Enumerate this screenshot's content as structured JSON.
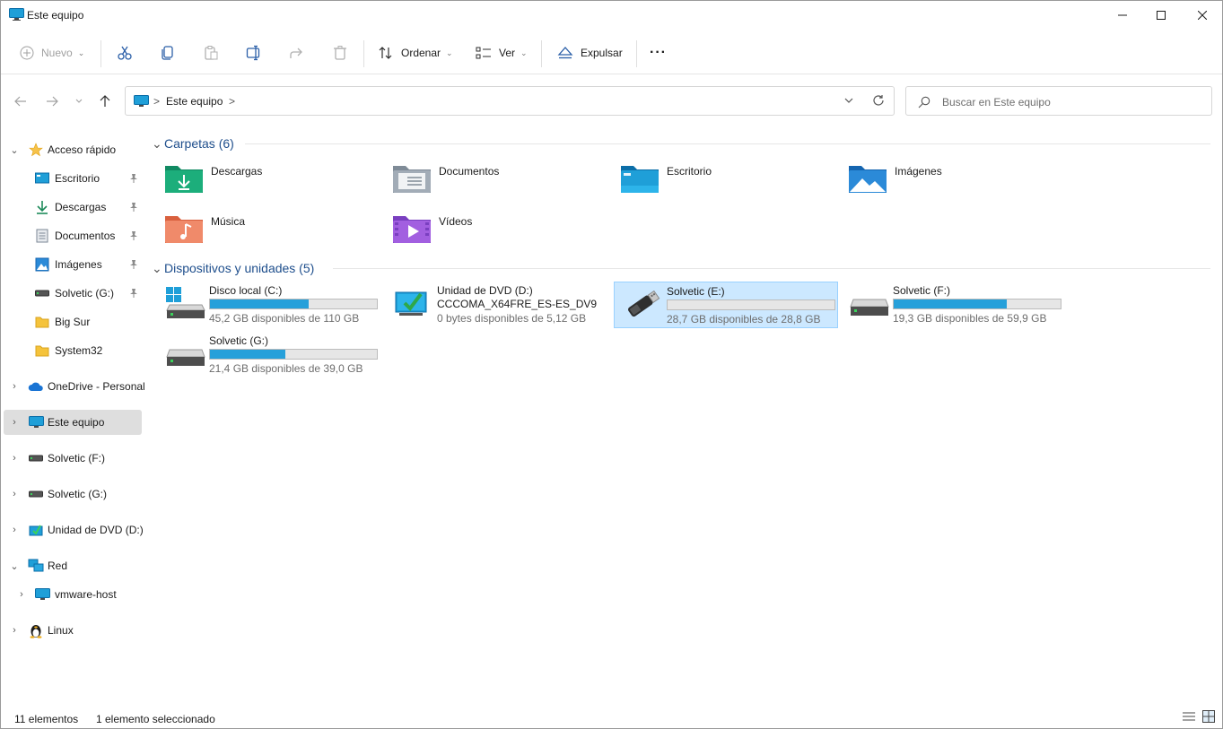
{
  "window": {
    "title": "Este equipo"
  },
  "commands": {
    "new": "Nuevo",
    "sort": "Ordenar",
    "view": "Ver",
    "eject": "Expulsar",
    "more": "···"
  },
  "address": {
    "crumb": "Este equipo",
    "separator": ">",
    "search_placeholder": "Buscar en Este equipo"
  },
  "sidebar": {
    "quick_access": "Acceso rápido",
    "quick_items": [
      {
        "label": "Escritorio",
        "icon": "desktop-icon",
        "pinned": true
      },
      {
        "label": "Descargas",
        "icon": "download-icon",
        "pinned": true
      },
      {
        "label": "Documentos",
        "icon": "documents-icon",
        "pinned": true
      },
      {
        "label": "Imágenes",
        "icon": "pictures-icon",
        "pinned": true
      },
      {
        "label": "Solvetic (G:)",
        "icon": "drive-icon",
        "pinned": true
      },
      {
        "label": "Big Sur",
        "icon": "folder-icon",
        "pinned": false
      },
      {
        "label": "System32",
        "icon": "folder-icon",
        "pinned": false
      }
    ],
    "onedrive": "OneDrive - Personal",
    "this_pc": "Este equipo",
    "drive_f": "Solvetic (F:)",
    "drive_g": "Solvetic (G:)",
    "dvd": "Unidad de DVD (D:)",
    "network": "Red",
    "vmware": "vmware-host",
    "linux": "Linux"
  },
  "folders_group": {
    "title": "Carpetas (6)",
    "items": [
      {
        "label": "Descargas",
        "icon": "downloads-folder-icon"
      },
      {
        "label": "Documentos",
        "icon": "documents-folder-icon"
      },
      {
        "label": "Escritorio",
        "icon": "desktop-folder-icon"
      },
      {
        "label": "Imágenes",
        "icon": "pictures-folder-icon"
      },
      {
        "label": "Música",
        "icon": "music-folder-icon"
      },
      {
        "label": "Vídeos",
        "icon": "videos-folder-icon"
      }
    ]
  },
  "devices_group": {
    "title": "Dispositivos y unidades (5)",
    "items": [
      {
        "name": "Disco local (C:)",
        "free": "45,2 GB disponibles de 110 GB",
        "used_fraction": 0.59,
        "icon": "windows-drive-icon"
      },
      {
        "name": "Unidad de DVD (D:)",
        "subtitle": "CCCOMA_X64FRE_ES-ES_DV9",
        "free": "0 bytes disponibles de 5,12 GB",
        "icon": "dvd-drive-icon"
      },
      {
        "name": "Solvetic (E:)",
        "free": "28,7 GB disponibles de 28,8 GB",
        "used_fraction": 0.0,
        "icon": "usb-drive-icon",
        "selected": true
      },
      {
        "name": "Solvetic (F:)",
        "free": "19,3 GB disponibles de 59,9 GB",
        "used_fraction": 0.68,
        "icon": "drive-icon"
      },
      {
        "name": "Solvetic (G:)",
        "free": "21,4 GB disponibles de 39,0 GB",
        "used_fraction": 0.45,
        "icon": "drive-icon"
      }
    ]
  },
  "status": {
    "count": "11 elementos",
    "selection": "1 elemento seleccionado"
  },
  "colors": {
    "accent": "#26a0da",
    "selection": "#cce8ff",
    "group_title": "#1e4e8c"
  }
}
